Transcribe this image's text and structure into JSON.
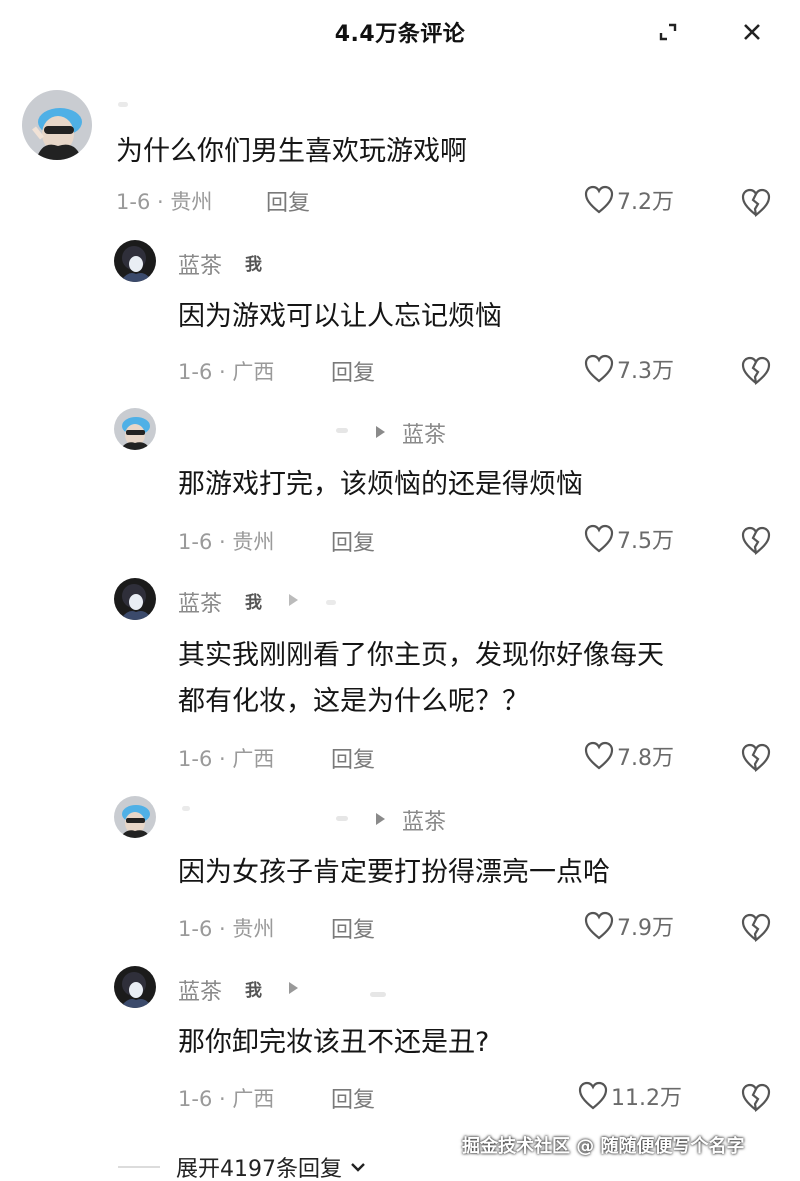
{
  "header": {
    "title": "4.4万条评论",
    "collapse_icon": "collapse-icon",
    "close_icon": "close-icon"
  },
  "comments": [
    {
      "username": "",
      "text": "为什么你们男生喜欢玩游戏啊",
      "meta": "1-6 · 贵州",
      "reply": "回复",
      "likes": "7.2万"
    },
    {
      "username": "蓝茶",
      "me": "我",
      "text": "因为游戏可以让人忘记烦恼",
      "meta": "1-6 · 广西",
      "reply": "回复",
      "likes": "7.3万"
    },
    {
      "username": "",
      "reply_to": "蓝茶",
      "text": "那游戏打完，该烦恼的还是得烦恼",
      "meta": "1-6 · 贵州",
      "reply": "回复",
      "likes": "7.5万"
    },
    {
      "username": "蓝茶",
      "me": "我",
      "text_line1": "其实我刚刚看了你主页，发现你好像每天",
      "text_line2": "都有化妆，这是为什么呢？？",
      "meta": "1-6 · 广西",
      "reply": "回复",
      "likes": "7.8万"
    },
    {
      "username": "",
      "reply_to": "蓝茶",
      "text": "因为女孩子肯定要打扮得漂亮一点哈",
      "meta": "1-6 · 贵州",
      "reply": "回复",
      "likes": "7.9万"
    },
    {
      "username": "蓝茶",
      "me": "我",
      "text": "那你卸完妆该丑不还是丑?",
      "meta": "1-6 · 广西",
      "reply": "回复",
      "likes": "11.2万"
    }
  ],
  "expand_label": "展开4197条回复",
  "watermark": "掘金技术社区 @ 随随便便写个名字"
}
